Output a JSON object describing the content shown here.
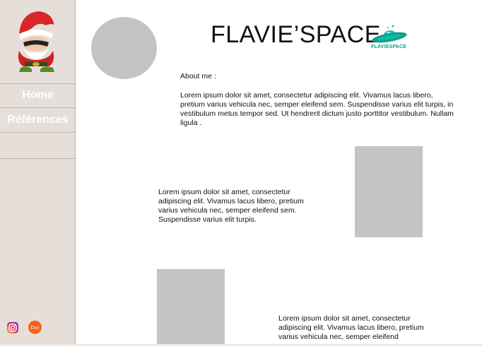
{
  "sidebar": {
    "nav": [
      {
        "label": "Home"
      },
      {
        "label": "Références"
      }
    ],
    "social": {
      "instagram_icon": "instagram-icon",
      "etsy_label": "Etsy"
    }
  },
  "header": {
    "title": "FLAVIE’SPACE",
    "logo_text": "FLAVIESPACE"
  },
  "about": {
    "label": "About me :",
    "text": "Lorem ipsum dolor sit amet, consectetur adipiscing elit. Vivamus lacus libero, pretium varius vehicula nec, semper eleifend sem. Suspendisse varius elit turpis, in vestibulum metus tempor sed. Ut hendrerit dictum justo porttitor vestibulum. Nullam ligula ."
  },
  "sections": [
    {
      "text": "Lorem ipsum dolor sit amet, consectetur adipiscing elit. Vivamus lacus libero, pretium varius vehicula nec, semper eleifend sem. Suspendisse varius elit turpis."
    },
    {
      "text": "Lorem ipsum dolor sit amet, consectetur adipiscing elit. Vivamus lacus libero, pretium varius vehicula nec, semper eleifend"
    }
  ],
  "colors": {
    "sidebar_bg": "#e6dfd9",
    "placeholder_gray": "#c4c4c4",
    "logo_teal": "#0a9f8b",
    "etsy_orange": "#f1641e"
  }
}
